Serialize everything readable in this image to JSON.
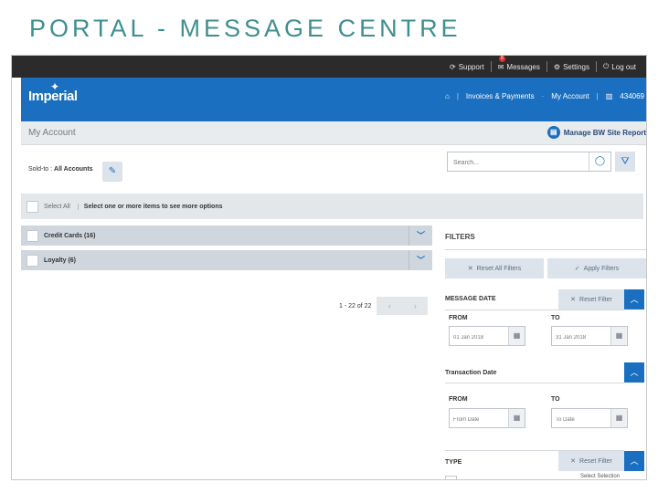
{
  "slide": {
    "title": "PORTAL - MESSAGE CENTRE"
  },
  "topbar": {
    "support": "Support",
    "messages": "Messages",
    "messages_badge": "9",
    "settings": "Settings",
    "logout": "Log out"
  },
  "header": {
    "logo": "Imperial",
    "nav_invoices": "Invoices & Payments",
    "nav_account": "My Account",
    "account_number": "434069"
  },
  "account_bar": {
    "title": "My Account",
    "manage": "Manage BW Site Report"
  },
  "sold_to": {
    "label": "Sold-to :",
    "value": "All Accounts"
  },
  "search": {
    "placeholder": "Search..."
  },
  "select_all": {
    "label": "Select All",
    "hint": "Select one or more items to see more options"
  },
  "groups": [
    {
      "label": "Credit Cards (16)"
    },
    {
      "label": "Loyalty (6)"
    }
  ],
  "pager": {
    "text": "1 - 22 of 22"
  },
  "filters": {
    "title": "FILTERS",
    "reset_all": "Reset All Filters",
    "apply": "Apply Filters",
    "message_date": {
      "title": "MESSAGE DATE",
      "reset": "Reset Filter",
      "from_label": "FROM",
      "to_label": "TO",
      "from_value": "01 Jan 2018",
      "to_value": "31 Jan 2018"
    },
    "transaction_date": {
      "title": "Transaction Date",
      "from_label": "FROM",
      "to_label": "TO",
      "from_placeholder": "From Date",
      "to_placeholder": "To Date"
    },
    "type": {
      "title": "TYPE",
      "reset": "Reset Filter",
      "select_partial": "Select Selection"
    }
  }
}
